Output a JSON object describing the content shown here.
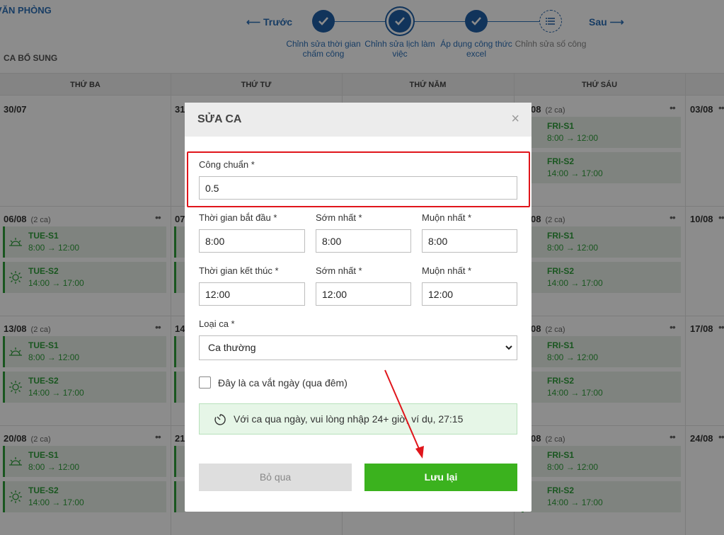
{
  "app": {
    "office_label": "VĂN PHÒNG",
    "section_label": "CA BỔ SUNG",
    "prev_label": "⟵ Trước",
    "next_label": "Sau ⟶",
    "steps": [
      {
        "label": "Chỉnh sửa thời gian chấm công",
        "state": "done"
      },
      {
        "label": "Chỉnh sửa lịch làm việc",
        "state": "active"
      },
      {
        "label": "Áp dụng công thức excel",
        "state": "done"
      },
      {
        "label": "Chỉnh sửa số công",
        "state": "todo"
      }
    ],
    "columns": [
      "THỨ BA",
      "THỨ TƯ",
      "THỨ NĂM",
      "THỨ SÁU"
    ],
    "rows": [
      {
        "tue": "30/07",
        "tue_count": "",
        "wed": "31",
        "fri": "08",
        "fri_count": "(2 ca)",
        "sat": "03/08"
      },
      {
        "tue": "06/08",
        "tue_count": "(2 ca)",
        "wed": "07",
        "fri": "08",
        "fri_count": "(2 ca)",
        "sat": "10/08"
      },
      {
        "tue": "13/08",
        "tue_count": "(2 ca)",
        "wed": "14",
        "fri": "08",
        "fri_count": "(2 ca)",
        "sat": "17/08"
      },
      {
        "tue": "20/08",
        "tue_count": "(2 ca)",
        "wed": "21",
        "fri": "08",
        "fri_count": "(2 ca)",
        "sat": "24/08"
      }
    ],
    "shifts": {
      "tue_s1_name": "TUE-S1",
      "tue_s1_time": "8:00 → 12:00",
      "tue_s2_name": "TUE-S2",
      "tue_s2_time": "14:00 → 17:00",
      "fri_s1_name": "FRI-S1",
      "fri_s1_time": "8:00 → 12:00",
      "fri_s2_name": "FRI-S2",
      "fri_s2_time": "14:00 → 17:00"
    }
  },
  "modal": {
    "title": "SỬA CA",
    "standard_label": "Công chuẩn *",
    "standard_value": "0.5",
    "start_label": "Thời gian bắt đầu *",
    "start_value": "8:00",
    "start_early_label": "Sớm nhất *",
    "start_early_value": "8:00",
    "start_late_label": "Muộn nhất *",
    "start_late_value": "8:00",
    "end_label": "Thời gian kết thúc *",
    "end_value": "12:00",
    "end_early_label": "Sớm nhất *",
    "end_early_value": "12:00",
    "end_late_label": "Muộn nhất *",
    "end_late_value": "12:00",
    "type_label": "Loại ca *",
    "type_value": "Ca thường",
    "overnight_label": "Đây là ca vắt ngày (qua đêm)",
    "note_text": "Với ca qua ngày, vui lòng nhập 24+ giờ, ví dụ, 27:15",
    "cancel_label": "Bỏ qua",
    "save_label": "Lưu lại"
  },
  "colors": {
    "accent_blue": "#1f5fa6",
    "shift_green": "#2e9d3a",
    "save_green": "#3bb21e",
    "annotation_red": "#e0151b"
  }
}
